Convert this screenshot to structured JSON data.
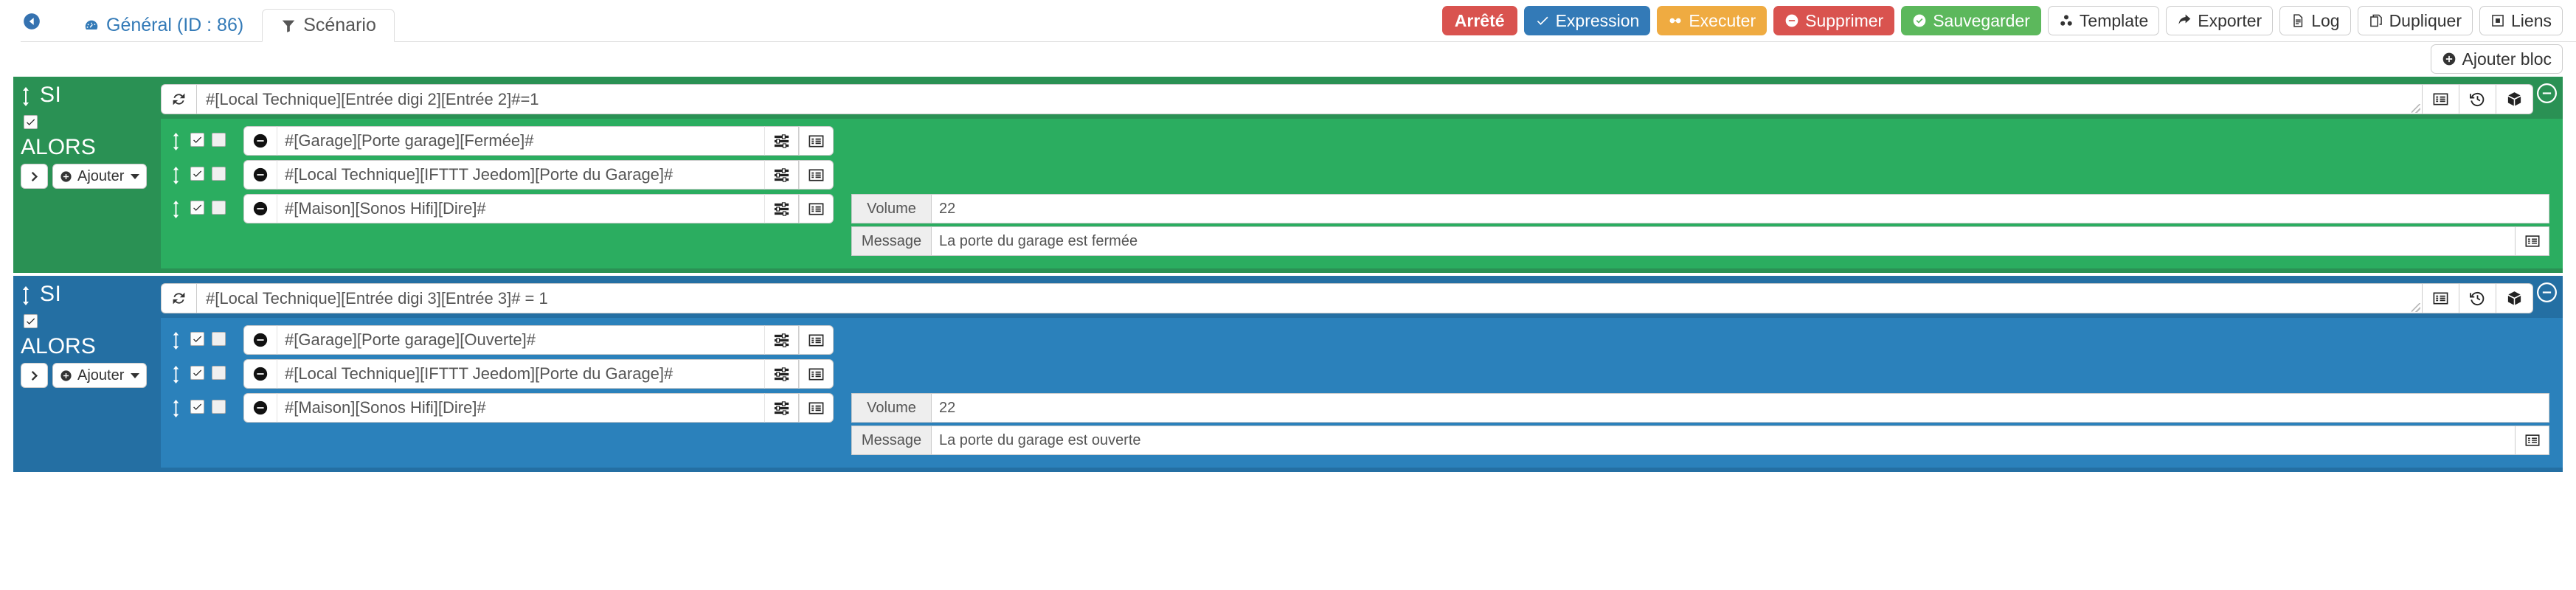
{
  "header": {
    "back_icon": "arrow-circle-left-icon",
    "tabs": [
      {
        "label": "Général (ID : 86)",
        "icon": "dashboard-icon",
        "active": false
      },
      {
        "label": "Scénario",
        "icon": "filter-icon",
        "active": true
      }
    ],
    "toolbar": {
      "status_label": "Arrêté",
      "status_color": "#d9534f",
      "buttons": [
        {
          "label": "Expression",
          "icon": "check-icon",
          "color": "#337ab7"
        },
        {
          "label": "Executer",
          "icon": "gears-icon",
          "color": "#efab41"
        },
        {
          "label": "Supprimer",
          "icon": "minus-circle-icon",
          "color": "#d9534f"
        },
        {
          "label": "Sauvegarder",
          "icon": "check-circle-icon",
          "color": "#5cb85c"
        },
        {
          "label": "Template",
          "icon": "cubes-icon",
          "color": "#ffffff"
        },
        {
          "label": "Exporter",
          "icon": "share-icon",
          "color": "#ffffff"
        },
        {
          "label": "Log",
          "icon": "file-text-icon",
          "color": "#ffffff"
        },
        {
          "label": "Dupliquer",
          "icon": "copy-icon",
          "color": "#ffffff"
        },
        {
          "label": "Liens",
          "icon": "link-diagram-icon",
          "color": "#ffffff"
        }
      ]
    }
  },
  "actions_bar": {
    "add_block_label": "Ajouter bloc",
    "add_block_icon": "plus-circle-icon"
  },
  "labels": {
    "si": "SI",
    "alors": "ALORS",
    "ajouter": "Ajouter",
    "volume": "Volume",
    "message": "Message"
  },
  "blocks": [
    {
      "type": "green",
      "color": "#2a9154",
      "inner_color": "#2bad60",
      "condition": "#[Local Technique][Entrée digi 2][Entrée 2]#=1",
      "actions": [
        {
          "expression": "#[Garage][Porte garage][Fermée]#",
          "enabled": true,
          "secondary": false
        },
        {
          "expression": "#[Local Technique][IFTTT Jeedom][Porte du Garage]#",
          "enabled": true,
          "secondary": false
        },
        {
          "expression": "#[Maison][Sonos Hifi][Dire]#",
          "enabled": true,
          "secondary": false,
          "params": [
            {
              "label": "Volume",
              "value": "22",
              "has_icon": false
            },
            {
              "label": "Message",
              "value": "La porte du garage est fermée",
              "has_icon": true
            }
          ]
        }
      ]
    },
    {
      "type": "blue",
      "color": "#246fa3",
      "inner_color": "#2b81bb",
      "condition": "#[Local Technique][Entrée digi 3][Entrée 3]# = 1",
      "actions": [
        {
          "expression": "#[Garage][Porte garage][Ouverte]#",
          "enabled": true,
          "secondary": false
        },
        {
          "expression": "#[Local Technique][IFTTT Jeedom][Porte du Garage]#",
          "enabled": true,
          "secondary": false
        },
        {
          "expression": "#[Maison][Sonos Hifi][Dire]#",
          "enabled": true,
          "secondary": false,
          "params": [
            {
              "label": "Volume",
              "value": "22",
              "has_icon": false
            },
            {
              "label": "Message",
              "value": "La porte du garage est ouverte",
              "has_icon": true
            }
          ]
        }
      ]
    }
  ],
  "icons": {
    "block_remove": "minus-circle-icon",
    "condition_refresh": "refresh-icon",
    "condition_list": "list-alt-icon",
    "condition_history": "history-icon",
    "condition_cube": "cube-icon",
    "action_remove": "minus-circle-icon",
    "action_sliders": "sliders-icon",
    "action_list": "list-alt-icon",
    "param_list": "list-alt-icon",
    "expand": "chevron-right-icon",
    "drag": "arrows-v-icon"
  }
}
